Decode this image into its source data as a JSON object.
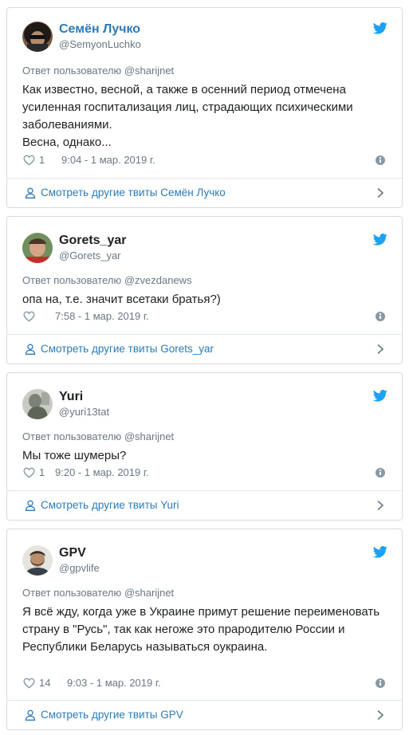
{
  "colors": {
    "link": "#2b7bb9",
    "meta": "#697882",
    "border": "#d6dbdf",
    "bird": "#1da1f2"
  },
  "icons": {
    "brand": "twitter-bird-icon",
    "like": "heart-icon",
    "info": "info-icon",
    "profile": "user-icon",
    "more": "chevron-right-icon"
  },
  "tweets": [
    {
      "name": "Семён Лучко",
      "handle": "@SemyonLuchko",
      "reply_to": "Ответ пользователю @sharijnet",
      "text": "Как известно, весной, а также в осенний период отмечена усиленная госпитализация лиц, страдающих психическими заболеваниями.\nВесна, однако...",
      "likes": "1",
      "time": "9:04 - 1 мар. 2019 г.",
      "more_label": "Смотреть другие твиты Семён Лучко"
    },
    {
      "name": "Gorets_yar",
      "handle": "@Gorets_yar",
      "reply_to": "Ответ пользователю @zvezdanews",
      "text": "опа на, т.е. значит всетаки братья?)",
      "likes": "",
      "time": "7:58 - 1 мар. 2019 г.",
      "more_label": "Смотреть другие твиты Gorets_yar"
    },
    {
      "name": "Yuri",
      "handle": "@yuri13tat",
      "reply_to": "Ответ пользователю @sharijnet",
      "text": "Мы тоже шумеры?",
      "likes": "1",
      "time": "9:20 - 1 мар. 2019 г.",
      "more_label": "Смотреть другие твиты Yuri"
    },
    {
      "name": "GPV",
      "handle": "@gpvlife",
      "reply_to": "Ответ пользователю @sharijnet",
      "text": "Я всё жду, когда уже в Украине примут решение переименовать страну в \"Русь\", так как негоже это прародителю России и Республики Беларусь называться оукраина.",
      "likes": "14",
      "time": "9:03 - 1 мар. 2019 г.",
      "more_label": "Смотреть другие твиты GPV"
    }
  ]
}
